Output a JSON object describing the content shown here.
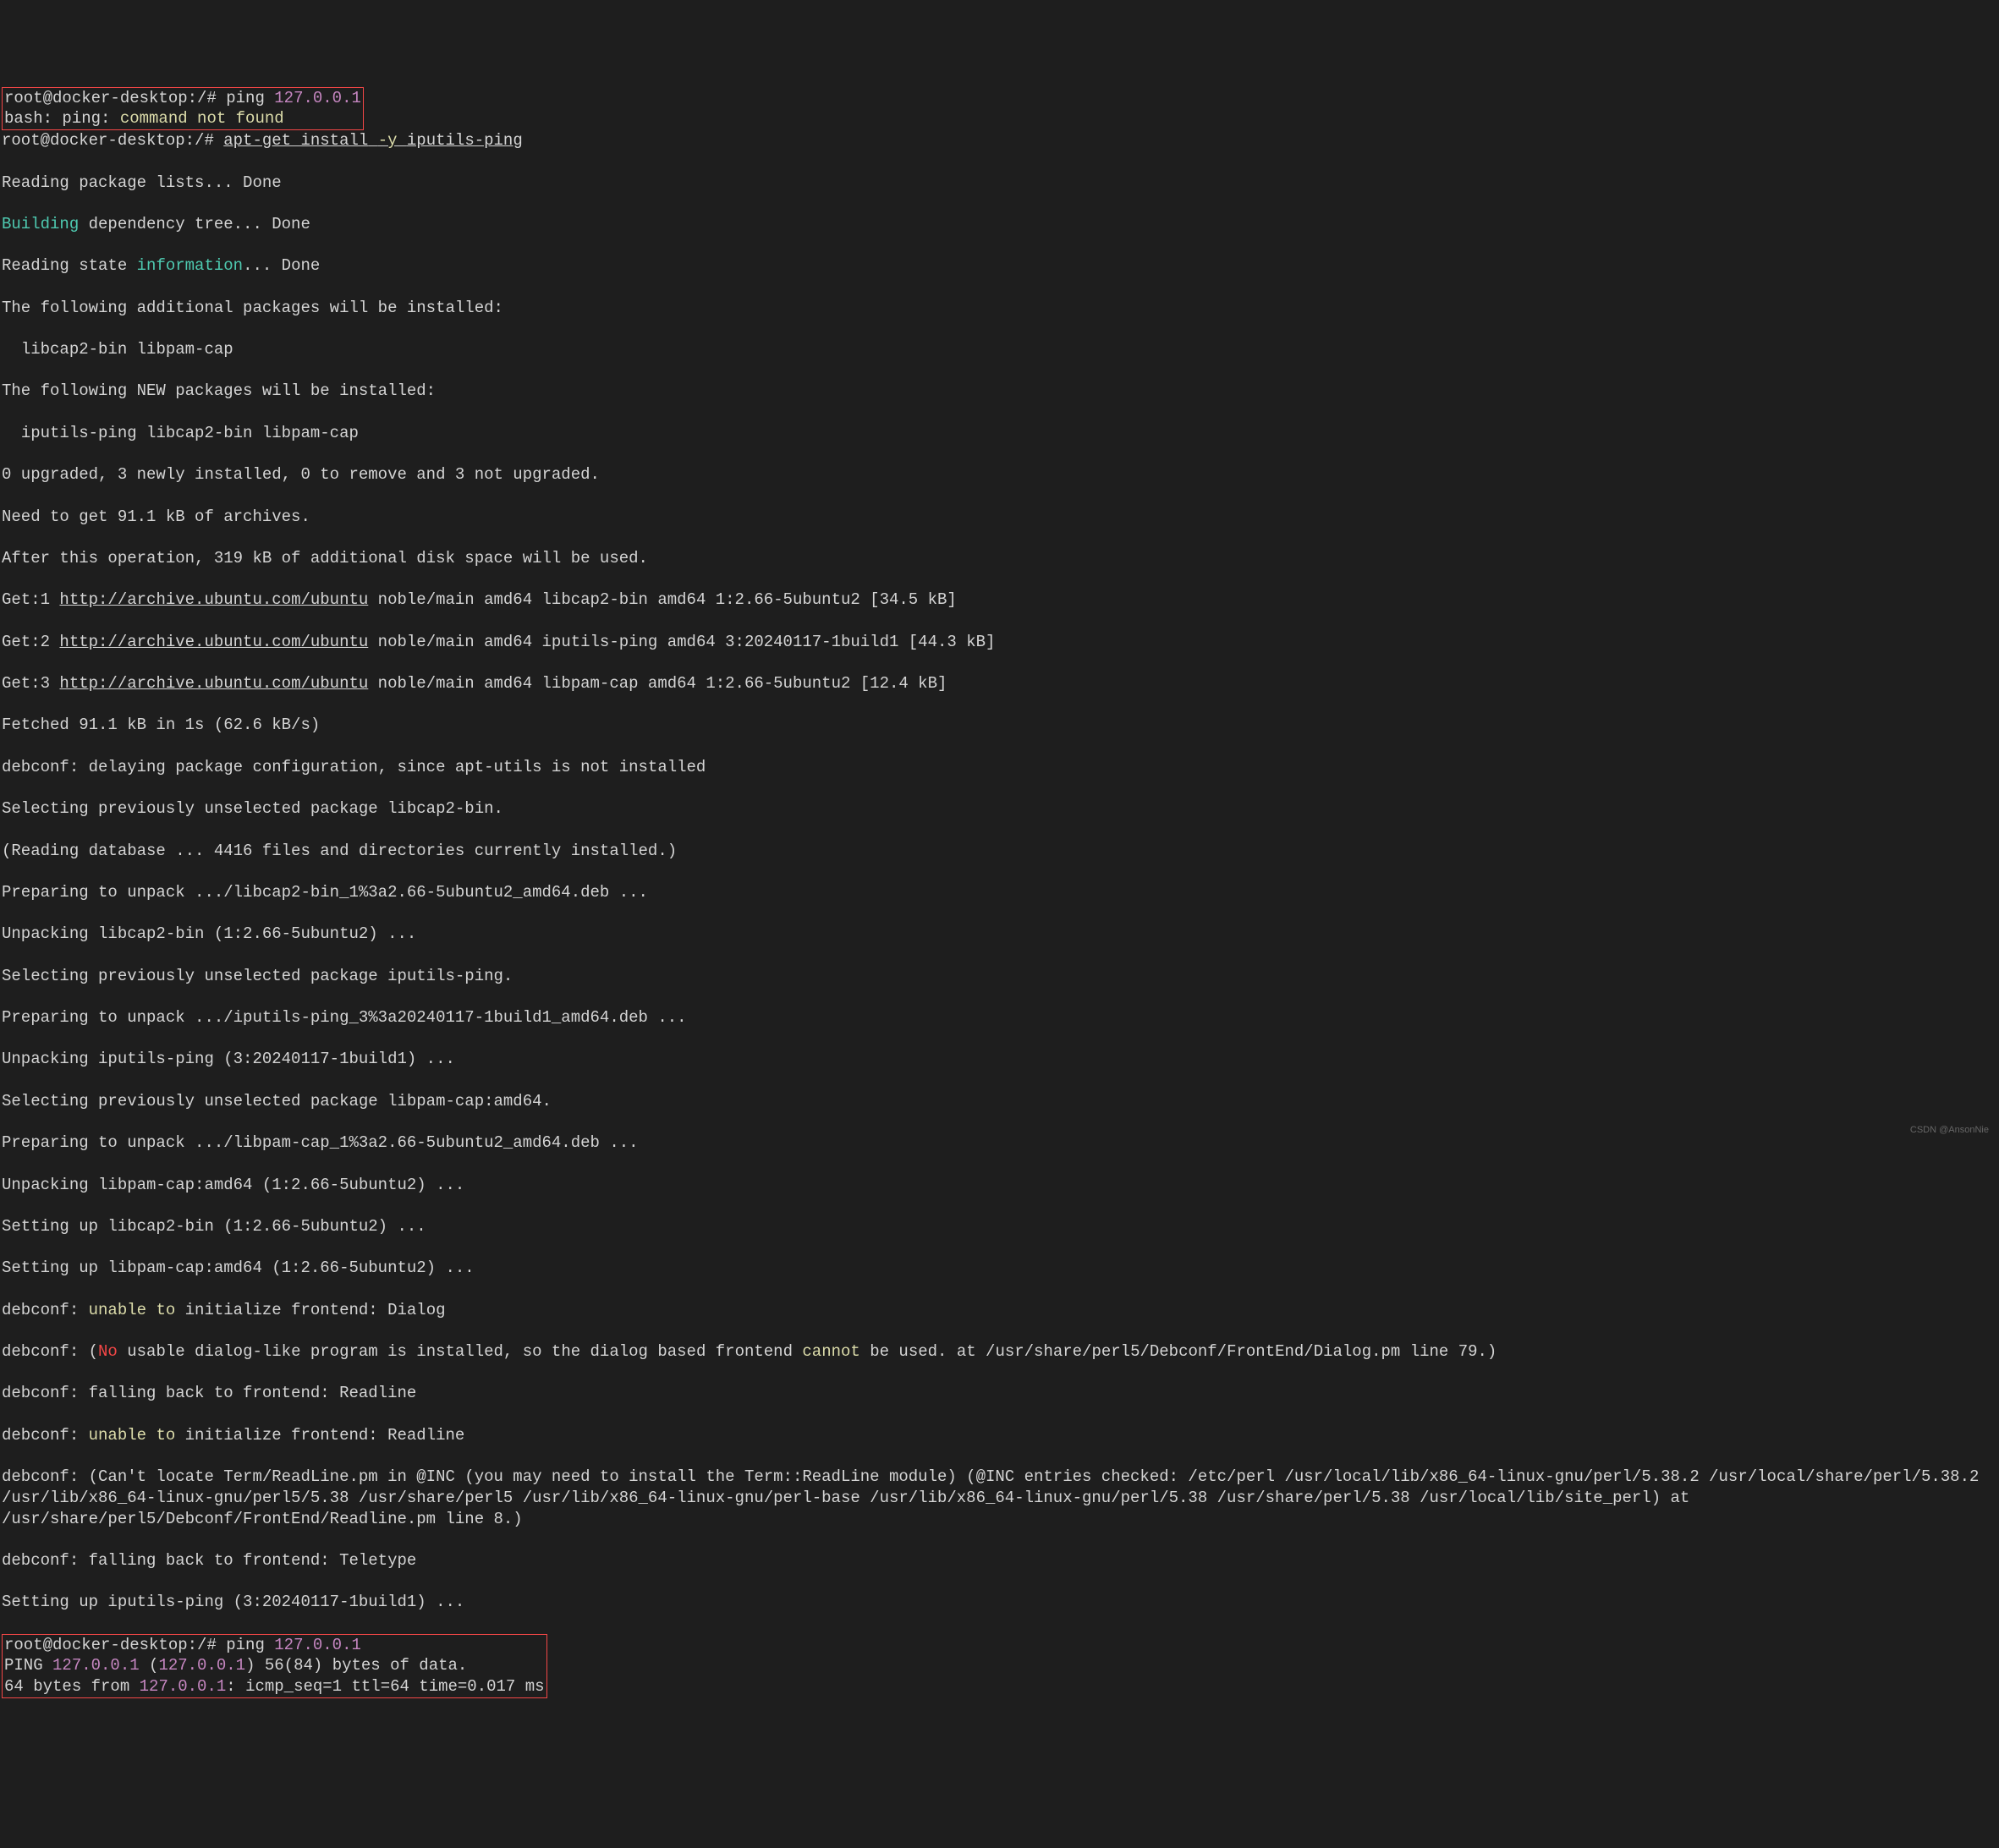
{
  "terminal": {
    "prompt": "root@docker-desktop:/#",
    "cmd1": "ping",
    "cmd1_arg": "127.0.0.1",
    "err1_prefix": "bash: ping:",
    "err1_msg": "command not found",
    "cmd2_prefix": "apt-get install",
    "cmd2_flag": "-y",
    "cmd2_pkg": "iputils-ping",
    "line_read_pkg": "Reading package lists... Done",
    "line_build_prefix": "Building",
    "line_build_suffix": " dependency tree... Done",
    "line_read_state_prefix": "Reading state ",
    "line_read_state_info": "information",
    "line_read_state_suffix": "... Done",
    "line_additional": "The following additional packages will be installed:",
    "line_additional_pkgs": "  libcap2-bin libpam-cap",
    "line_new": "The following NEW packages will be installed:",
    "line_new_pkgs": "  iputils-ping libcap2-bin libpam-cap",
    "line_upgraded": "0 upgraded, 3 newly installed, 0 to remove and 3 not upgraded.",
    "line_need_get": "Need to get 91.1 kB of archives.",
    "line_after_op": "After this operation, 319 kB of additional disk space will be used.",
    "get1_prefix": "Get:1 ",
    "get1_url": "http://archive.ubuntu.com/ubuntu",
    "get1_suffix": " noble/main amd64 libcap2-bin amd64 1:2.66-5ubuntu2 [34.5 kB]",
    "get2_prefix": "Get:2 ",
    "get2_url": "http://archive.ubuntu.com/ubuntu",
    "get2_suffix": " noble/main amd64 iputils-ping amd64 3:20240117-1build1 [44.3 kB]",
    "get3_prefix": "Get:3 ",
    "get3_url": "http://archive.ubuntu.com/ubuntu",
    "get3_suffix": " noble/main amd64 libpam-cap amd64 1:2.66-5ubuntu2 [12.4 kB]",
    "line_fetched": "Fetched 91.1 kB in 1s (62.6 kB/s)",
    "line_debconf_delay": "debconf: delaying package configuration, since apt-utils is not installed",
    "line_sel_libcap": "Selecting previously unselected package libcap2-bin.",
    "line_read_db": "(Reading database ... 4416 files and directories currently installed.)",
    "line_prep_libcap": "Preparing to unpack .../libcap2-bin_1%3a2.66-5ubuntu2_amd64.deb ...",
    "line_unpack_libcap": "Unpacking libcap2-bin (1:2.66-5ubuntu2) ...",
    "line_sel_iputils": "Selecting previously unselected package iputils-ping.",
    "line_prep_iputils": "Preparing to unpack .../iputils-ping_3%3a20240117-1build1_amd64.deb ...",
    "line_unpack_iputils": "Unpacking iputils-ping (3:20240117-1build1) ...",
    "line_sel_libpam": "Selecting previously unselected package libpam-cap:amd64.",
    "line_prep_libpam": "Preparing to unpack .../libpam-cap_1%3a2.66-5ubuntu2_amd64.deb ...",
    "line_unpack_libpam": "Unpacking libpam-cap:amd64 (1:2.66-5ubuntu2) ...",
    "line_setup_libcap": "Setting up libcap2-bin (1:2.66-5ubuntu2) ...",
    "line_setup_libpam": "Setting up libpam-cap:amd64 (1:2.66-5ubuntu2) ...",
    "debconf_unable_prefix": "debconf: ",
    "debconf_unable": "unable to",
    "debconf_unable_suffix_dialog": " initialize frontend: Dialog",
    "debconf_no_prefix": "debconf: (",
    "debconf_no": "No",
    "debconf_no_mid": " usable dialog-like program is installed, so the dialog based frontend ",
    "debconf_cannot": "cannot",
    "debconf_no_suffix": " be used. at /usr/share/perl5/Debconf/FrontEnd/Dialog.pm line 79.)",
    "debconf_fallback_readline": "debconf: falling back to frontend: Readline",
    "debconf_unable_suffix_readline": " initialize frontend: Readline",
    "debconf_cant_locate": "debconf: (Can't locate Term/ReadLine.pm in @INC (you may need to install the Term::ReadLine module) (@INC entries checked: /etc/perl /usr/local/lib/x86_64-linux-gnu/perl/5.38.2 /usr/local/share/perl/5.38.2 /usr/lib/x86_64-linux-gnu/perl5/5.38 /usr/share/perl5 /usr/lib/x86_64-linux-gnu/perl-base /usr/lib/x86_64-linux-gnu/perl/5.38 /usr/share/perl/5.38 /usr/local/lib/site_perl) at /usr/share/perl5/Debconf/FrontEnd/Readline.pm line 8.)",
    "debconf_fallback_teletype": "debconf: falling back to frontend: Teletype",
    "line_setup_iputils": "Setting up iputils-ping (3:20240117-1build1) ...",
    "cmd3": "ping",
    "cmd3_arg": "127.0.0.1",
    "ping_header_prefix": "PING ",
    "ping_ip": "127.0.0.1",
    "ping_header_mid": " (",
    "ping_header_suffix": ") 56(84) bytes of data.",
    "ping_reply_prefix": "64 bytes from ",
    "ping_reply_suffix": ": icmp_seq=1 ttl=64 time=0.017 ms"
  },
  "watermark": "CSDN @AnsonNie"
}
